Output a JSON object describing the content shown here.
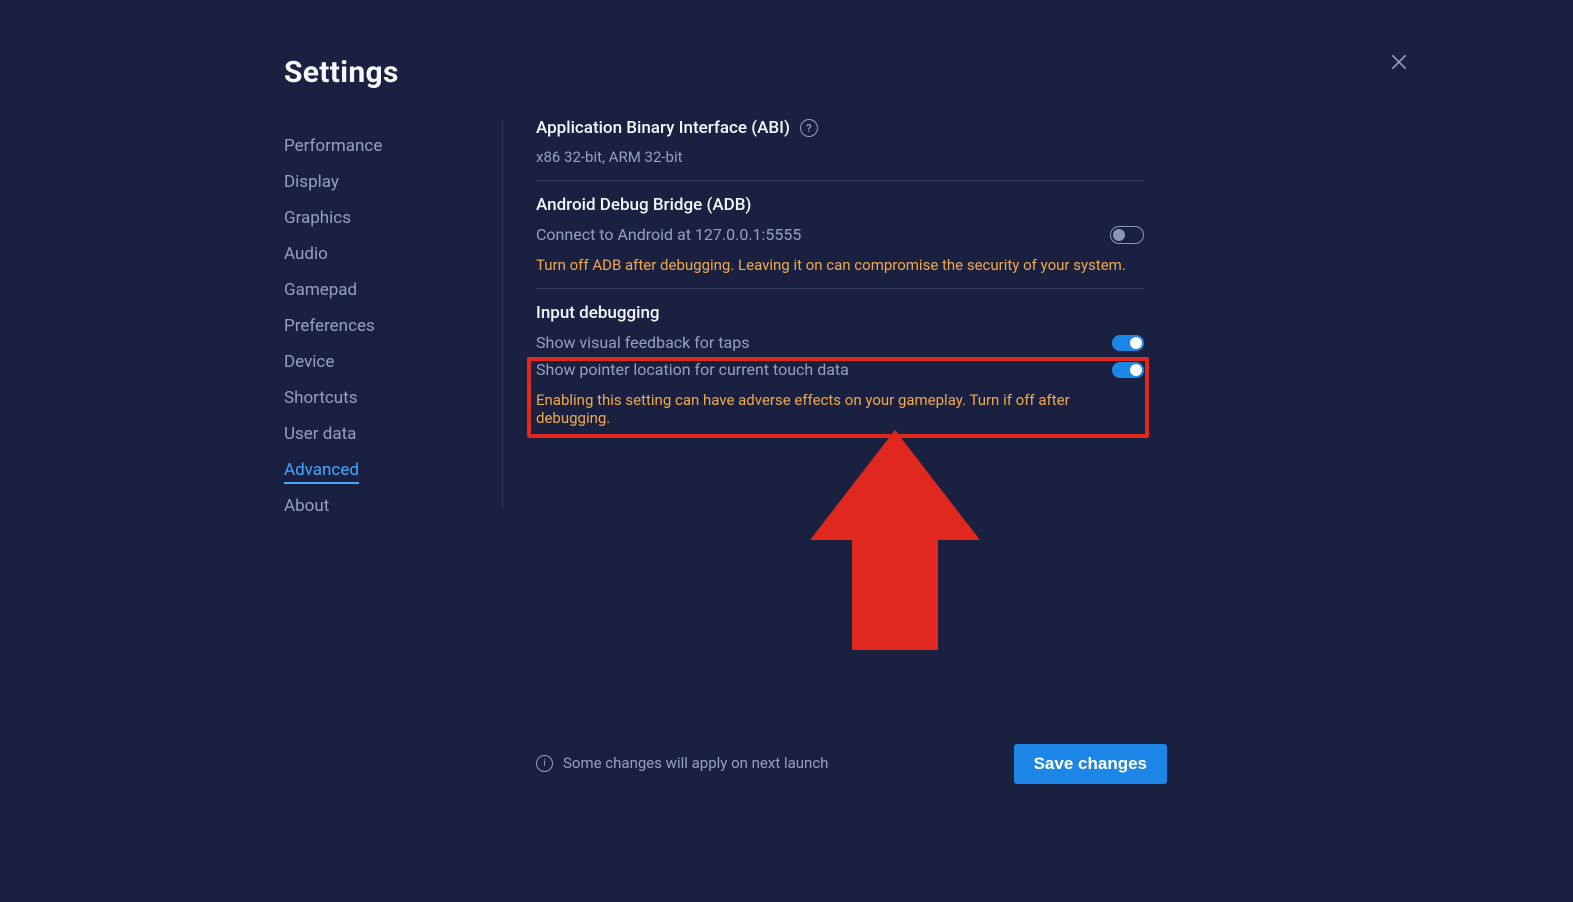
{
  "title": "Settings",
  "sidebar": {
    "items": [
      {
        "label": "Performance",
        "active": false
      },
      {
        "label": "Display",
        "active": false
      },
      {
        "label": "Graphics",
        "active": false
      },
      {
        "label": "Audio",
        "active": false
      },
      {
        "label": "Gamepad",
        "active": false
      },
      {
        "label": "Preferences",
        "active": false
      },
      {
        "label": "Device",
        "active": false
      },
      {
        "label": "Shortcuts",
        "active": false
      },
      {
        "label": "User data",
        "active": false
      },
      {
        "label": "Advanced",
        "active": true
      },
      {
        "label": "About",
        "active": false
      }
    ]
  },
  "content": {
    "abi": {
      "heading": "Application Binary Interface (ABI)",
      "value": "x86 32-bit, ARM 32-bit",
      "help_tooltip": "?"
    },
    "adb": {
      "heading": "Android Debug Bridge (ADB)",
      "connect_label": "Connect to Android at 127.0.0.1:5555",
      "connect_enabled": false,
      "warning": "Turn off ADB after debugging. Leaving it on can compromise the security of your system."
    },
    "input_debug": {
      "heading": "Input debugging",
      "taps_label": "Show visual feedback for taps",
      "taps_enabled": true,
      "pointer_label": "Show pointer location for current touch data",
      "pointer_enabled": true,
      "warning": "Enabling this setting can have adverse effects on your gameplay. Turn if off after debugging."
    }
  },
  "footer": {
    "note": "Some changes will apply on next launch",
    "save_label": "Save changes"
  }
}
